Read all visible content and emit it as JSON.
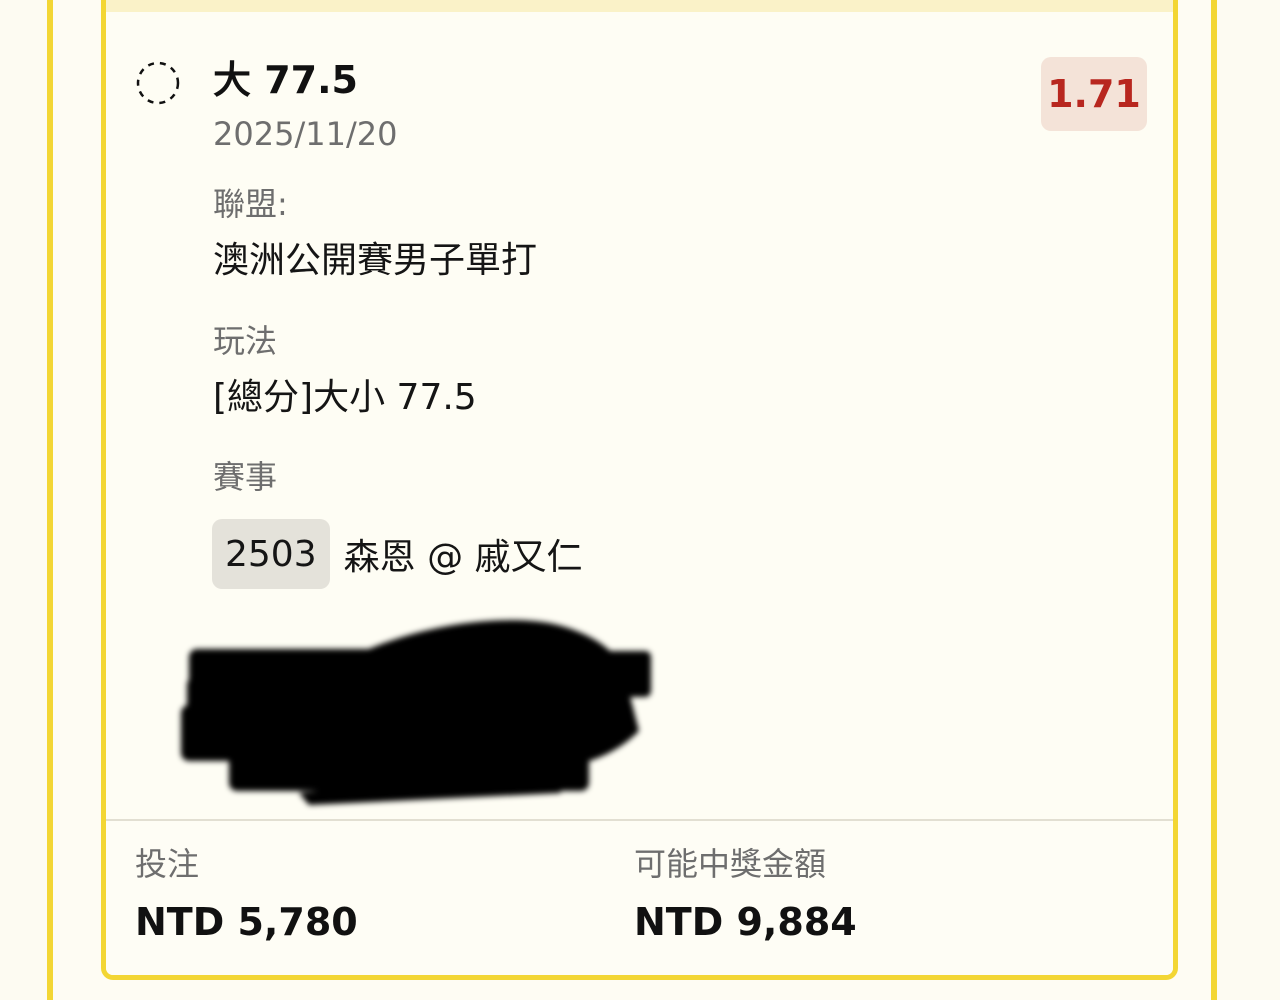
{
  "bet": {
    "selection": "大 77.5",
    "date": "2025/11/20",
    "odds": "1.71",
    "status_icon": "pending-dashed-circle-icon"
  },
  "details": {
    "league_label": "聯盟:",
    "league_value": "澳洲公開賽男子單打",
    "play_label": "玩法",
    "play_value": "[總分]大小 77.5",
    "event_label": "賽事",
    "event_code": "2503",
    "event_name": "森恩 @ 戚又仁"
  },
  "summary": {
    "stake_label": "投注",
    "stake_value": "NTD 5,780",
    "payout_label": "可能中獎金額",
    "payout_value": "NTD 9,884"
  },
  "colors": {
    "accent_yellow": "#f3d634",
    "odds_text": "#b8271f",
    "odds_bg": "#f4e3d8",
    "event_code_bg": "#e4e2da"
  }
}
